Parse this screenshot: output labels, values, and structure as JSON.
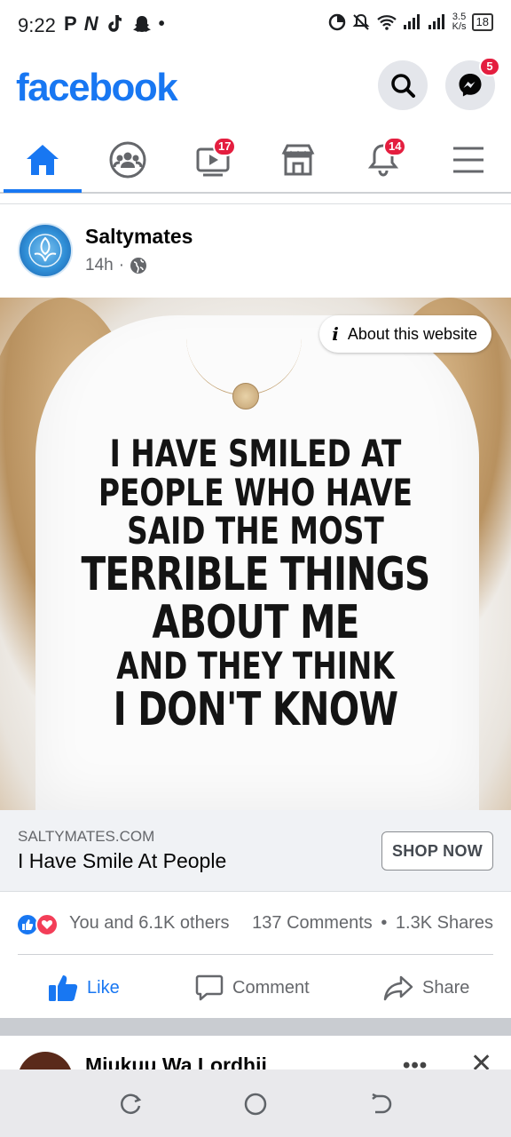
{
  "status_bar": {
    "time": "9:22",
    "left_icons": [
      "P",
      "N",
      "tiktok-icon",
      "snapchat-icon",
      "•"
    ],
    "net_speed_value": "3.5",
    "net_speed_unit": "K/s",
    "battery": "18"
  },
  "header": {
    "logo": "facebook",
    "messenger_badge": "5"
  },
  "nav": {
    "tabs": [
      {
        "name": "home",
        "badge": ""
      },
      {
        "name": "groups",
        "badge": ""
      },
      {
        "name": "video",
        "badge": "17"
      },
      {
        "name": "marketplace",
        "badge": ""
      },
      {
        "name": "notifications",
        "badge": "14"
      },
      {
        "name": "menu",
        "badge": ""
      }
    ],
    "active_tab": "home"
  },
  "post": {
    "page_name": "Saltymates",
    "time": "14h",
    "separator": "·",
    "about_website": "About this website",
    "shirt_lines": [
      "I HAVE SMILED AT",
      "PEOPLE WHO HAVE",
      "SAID THE MOST",
      "TERRIBLE THINGS",
      "ABOUT ME",
      "AND THEY THINK",
      "I DON'T KNOW"
    ],
    "link": {
      "domain": "SALTYMATES.COM",
      "title": "I Have Smile At People",
      "cta": "SHOP NOW"
    },
    "reactions": {
      "count_text": "You and 6.1K others",
      "comments": "137 Comments",
      "dot": "•",
      "shares": "1.3K Shares"
    },
    "actions": {
      "like": "Like",
      "comment": "Comment",
      "share": "Share"
    }
  },
  "next_post": {
    "name": "Mjukuu Wa Lordhii",
    "more": "•••",
    "close": "✕"
  },
  "colors": {
    "brand": "#1877f2",
    "badge": "#e41e3f",
    "love": "#f33e58",
    "muted_text": "#65676b"
  }
}
